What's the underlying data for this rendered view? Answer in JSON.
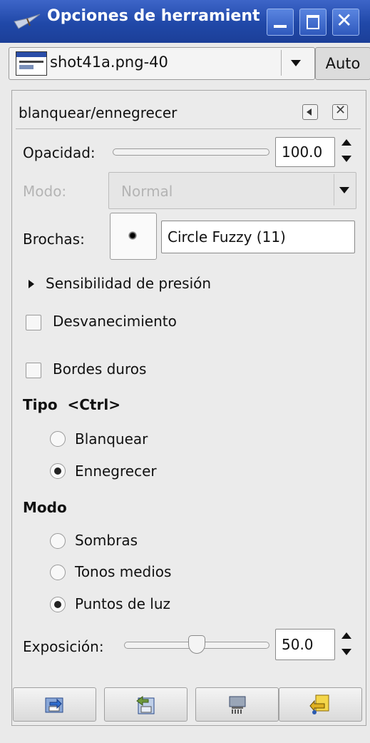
{
  "window": {
    "title": "Opciones de herramient"
  },
  "image_selector": {
    "value": "shot41a.png-40",
    "auto_label": "Auto"
  },
  "panel": {
    "title": "blanquear/ennegrecer"
  },
  "opacity": {
    "label": "Opacidad:",
    "value": "100.0"
  },
  "mode": {
    "label": "Modo:",
    "value": "Normal"
  },
  "brushes": {
    "label": "Brochas:",
    "value": "Circle Fuzzy (11)"
  },
  "pressure": {
    "label": "Sensibilidad de presión"
  },
  "fade": {
    "label": "Desvanecimiento",
    "checked": false
  },
  "hard_edges": {
    "label": "Bordes duros",
    "checked": false
  },
  "type": {
    "heading": "Tipo  <Ctrl>",
    "options": [
      "Blanquear",
      "Ennegrecer"
    ],
    "selected": "Ennegrecer"
  },
  "range": {
    "heading": "Modo",
    "options": [
      "Sombras",
      "Tonos medios",
      "Puntos de luz"
    ],
    "selected": "Puntos de luz"
  },
  "exposure": {
    "label": "Exposición:",
    "value": "50.0",
    "level_fraction": 0.5
  },
  "icons": {
    "title": "gimp-brush-icon",
    "minimize": "minimize-icon",
    "maximize": "maximize-icon",
    "close": "close-icon",
    "save": "save-options-icon",
    "restore": "restore-options-icon",
    "delete": "delete-options-icon",
    "reset": "reset-options-icon"
  },
  "colors": {
    "titlebar": "#2048a8",
    "panel_bg": "#ebebeb"
  }
}
